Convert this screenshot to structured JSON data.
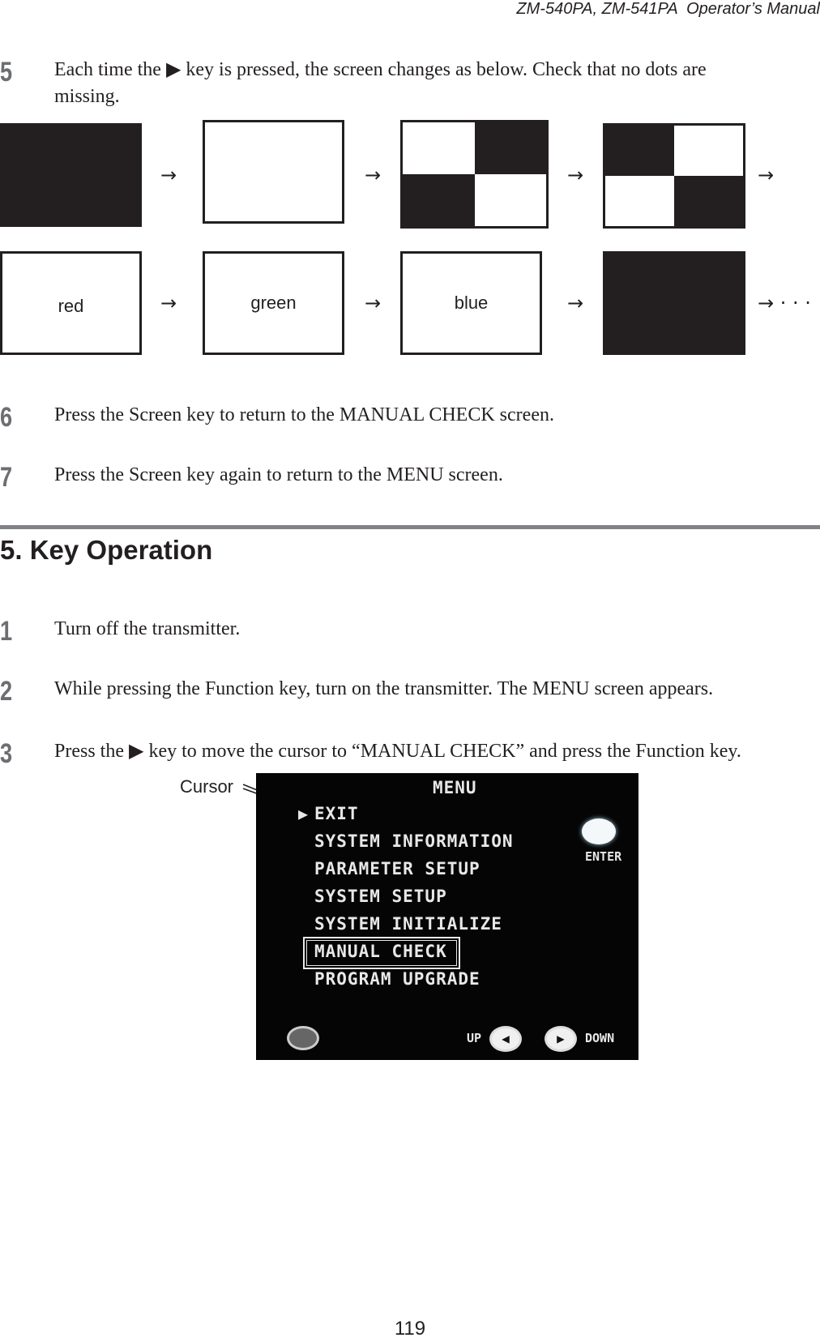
{
  "header": {
    "title": "ZM-540PA, ZM-541PA  Operator’s Manual"
  },
  "steps_top": [
    {
      "num": "5",
      "text_line1": "Each time the ▶ key is pressed, the screen changes as below. Check that no dots are",
      "text_line2": "missing."
    },
    {
      "num": "6",
      "text": "Press the Screen key to return to the MANUAL CHECK screen."
    },
    {
      "num": "7",
      "text": "Press the Screen key again to return to the MENU screen."
    }
  ],
  "pattern_sequence": {
    "row1": [
      "black",
      "white",
      "checker-a",
      "checker-b"
    ],
    "row2": [
      "red",
      "green",
      "blue",
      "black"
    ],
    "arrow": "→",
    "continue": "→ · · ·",
    "labels": {
      "red": "red",
      "green": "green",
      "blue": "blue"
    }
  },
  "section": {
    "title": "5. Key Operation"
  },
  "steps_key": [
    {
      "num": "1",
      "text": "Turn off the transmitter."
    },
    {
      "num": "2",
      "text": "While pressing the Function key, turn on the transmitter. The MENU screen appears."
    },
    {
      "num": "3",
      "text": "Press the ▶ key to move the cursor to “MANUAL CHECK” and press the Function key."
    }
  ],
  "menu_screen": {
    "callout": "Cursor",
    "title": "MENU",
    "cursor": "▶",
    "items": [
      "EXIT",
      "SYSTEM INFORMATION",
      "PARAMETER SETUP",
      "SYSTEM SETUP",
      "SYSTEM INITIALIZE",
      "MANUAL CHECK",
      "PROGRAM UPGRADE"
    ],
    "selected_item": "MANUAL CHECK",
    "enter_label": "ENTER",
    "up_label": "UP",
    "down_label": "DOWN"
  },
  "footer": {
    "page_number": "119"
  }
}
